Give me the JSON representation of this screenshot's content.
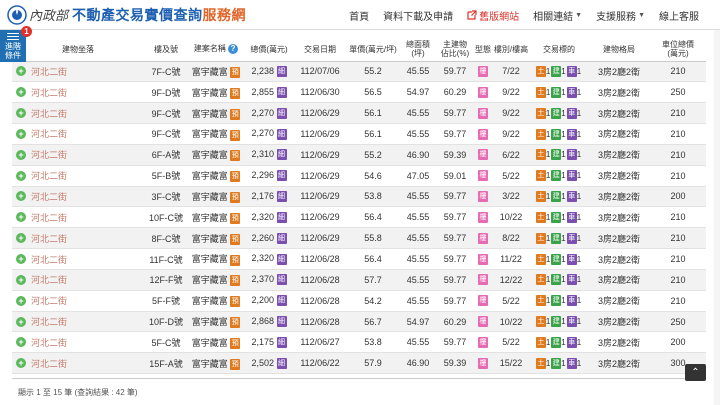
{
  "header": {
    "gov_name": "內政部",
    "title_blue": "不動產交易實價查詢",
    "title_orange": "服務網",
    "nav": [
      {
        "label": "首頁"
      },
      {
        "label": "資料下載及申請"
      },
      {
        "label": "舊版網站"
      },
      {
        "label": "相關連結"
      },
      {
        "label": "支援服務"
      },
      {
        "label": "線上客服"
      }
    ]
  },
  "filter": {
    "label_line1": "進階",
    "label_line2": "條件",
    "badge": "1"
  },
  "table": {
    "columns": {
      "addr": "建物坐落",
      "floor": "樓及號",
      "project": "建案名稱",
      "total": "總價(萬元)",
      "date": "交易日期",
      "unit": "單價(萬元/坪)",
      "area_l1": "總面積",
      "area_l2": "(坪)",
      "main_l1": "主建物",
      "main_l2": "佔比(%)",
      "type": "型態",
      "height": "樓別/樓高",
      "target": "交易標的",
      "layout": "建物格局",
      "avg_l1": "車位總價",
      "avg_l2": "(萬元)"
    },
    "tag_labels": {
      "detail": "細",
      "presale": "預",
      "build": "樓",
      "land": "土",
      "bld": "建",
      "car": "車"
    },
    "rows": [
      {
        "addr": "河北二街",
        "floor": "7F-C號",
        "project": "富宇藏富",
        "total": "2,238",
        "date": "112/07/06",
        "unit": "55.2",
        "area": "45.55",
        "main": "59.77",
        "height": "7/22",
        "land": "1",
        "bld": "1",
        "car": "1",
        "layout": "3房2廳2衛",
        "car_price": "210"
      },
      {
        "addr": "河北二街",
        "floor": "9F-D號",
        "project": "富宇藏富",
        "total": "2,855",
        "date": "112/06/30",
        "unit": "56.5",
        "area": "54.97",
        "main": "60.29",
        "height": "9/22",
        "land": "1",
        "bld": "1",
        "car": "1",
        "layout": "3房2廳2衛",
        "car_price": "250"
      },
      {
        "addr": "河北二街",
        "floor": "9F-C號",
        "project": "富宇藏富",
        "total": "2,270",
        "date": "112/06/29",
        "unit": "56.1",
        "area": "45.55",
        "main": "59.77",
        "height": "9/22",
        "land": "1",
        "bld": "1",
        "car": "1",
        "layout": "3房2廳2衛",
        "car_price": "210"
      },
      {
        "addr": "河北二街",
        "floor": "9F-C號",
        "project": "富宇藏富",
        "total": "2,270",
        "date": "112/06/29",
        "unit": "56.1",
        "area": "45.55",
        "main": "59.77",
        "height": "9/22",
        "land": "1",
        "bld": "1",
        "car": "1",
        "layout": "3房2廳2衛",
        "car_price": "210"
      },
      {
        "addr": "河北二街",
        "floor": "6F-A號",
        "project": "富宇藏富",
        "total": "2,310",
        "date": "112/06/29",
        "unit": "55.2",
        "area": "46.90",
        "main": "59.39",
        "height": "6/22",
        "land": "1",
        "bld": "1",
        "car": "1",
        "layout": "3房2廳2衛",
        "car_price": "210"
      },
      {
        "addr": "河北二街",
        "floor": "5F-B號",
        "project": "富宇藏富",
        "total": "2,296",
        "date": "112/06/29",
        "unit": "54.6",
        "area": "47.05",
        "main": "59.01",
        "height": "5/22",
        "land": "1",
        "bld": "1",
        "car": "1",
        "layout": "3房2廳2衛",
        "car_price": "210"
      },
      {
        "addr": "河北二街",
        "floor": "3F-C號",
        "project": "富宇藏富",
        "total": "2,176",
        "date": "112/06/29",
        "unit": "53.8",
        "area": "45.55",
        "main": "59.77",
        "height": "3/22",
        "land": "1",
        "bld": "1",
        "car": "1",
        "layout": "3房2廳2衛",
        "car_price": "200"
      },
      {
        "addr": "河北二街",
        "floor": "10F-C號",
        "project": "富宇藏富",
        "total": "2,320",
        "date": "112/06/29",
        "unit": "56.4",
        "area": "45.55",
        "main": "59.77",
        "height": "10/22",
        "land": "1",
        "bld": "1",
        "car": "1",
        "layout": "3房2廳2衛",
        "car_price": "210"
      },
      {
        "addr": "河北二街",
        "floor": "8F-C號",
        "project": "富宇藏富",
        "total": "2,260",
        "date": "112/06/29",
        "unit": "55.8",
        "area": "45.55",
        "main": "59.77",
        "height": "8/22",
        "land": "1",
        "bld": "1",
        "car": "1",
        "layout": "3房2廳2衛",
        "car_price": "210"
      },
      {
        "addr": "河北二街",
        "floor": "11F-C號",
        "project": "富宇藏富",
        "total": "2,320",
        "date": "112/06/28",
        "unit": "56.4",
        "area": "45.55",
        "main": "59.77",
        "height": "11/22",
        "land": "1",
        "bld": "1",
        "car": "1",
        "layout": "3房2廳2衛",
        "car_price": "210"
      },
      {
        "addr": "河北二街",
        "floor": "12F-F號",
        "project": "富宇藏富",
        "total": "2,370",
        "date": "112/06/28",
        "unit": "57.7",
        "area": "45.55",
        "main": "59.77",
        "height": "12/22",
        "land": "1",
        "bld": "1",
        "car": "1",
        "layout": "3房2廳2衛",
        "car_price": "210"
      },
      {
        "addr": "河北二街",
        "floor": "5F-F號",
        "project": "富宇藏富",
        "total": "2,200",
        "date": "112/06/28",
        "unit": "54.2",
        "area": "45.55",
        "main": "59.77",
        "height": "5/22",
        "land": "1",
        "bld": "1",
        "car": "1",
        "layout": "3房2廳2衛",
        "car_price": "210"
      },
      {
        "addr": "河北二街",
        "floor": "10F-D號",
        "project": "富宇藏富",
        "total": "2,868",
        "date": "112/06/28",
        "unit": "56.7",
        "area": "54.97",
        "main": "60.29",
        "height": "10/22",
        "land": "1",
        "bld": "1",
        "car": "1",
        "layout": "3房2廳2衛",
        "car_price": "250"
      },
      {
        "addr": "河北二街",
        "floor": "5F-C號",
        "project": "富宇藏富",
        "total": "2,175",
        "date": "112/06/27",
        "unit": "53.8",
        "area": "45.55",
        "main": "59.77",
        "height": "5/22",
        "land": "1",
        "bld": "1",
        "car": "1",
        "layout": "3房2廳2衛",
        "car_price": "200"
      },
      {
        "addr": "河北二街",
        "floor": "15F-A號",
        "project": "富宇藏富",
        "total": "2,502",
        "date": "112/06/22",
        "unit": "57.9",
        "area": "46.90",
        "main": "59.39",
        "height": "15/22",
        "land": "1",
        "bld": "1",
        "car": "1",
        "layout": "3房2廳2衛",
        "car_price": "300"
      }
    ]
  },
  "footer": {
    "summary": "顯示 1 至 15 筆 (查詢結果 : 42 筆)"
  },
  "scroll_top": {
    "glyph": "⌃"
  },
  "colors": {
    "brand_blue": "#1d5fb0",
    "brand_orange": "#e0662a",
    "link": "#c47b6a",
    "purple_tag": "#7a4fb0",
    "orange_tag": "#e07a1f",
    "pink_tag": "#e66bb2",
    "green_tag": "#3aa34a"
  }
}
